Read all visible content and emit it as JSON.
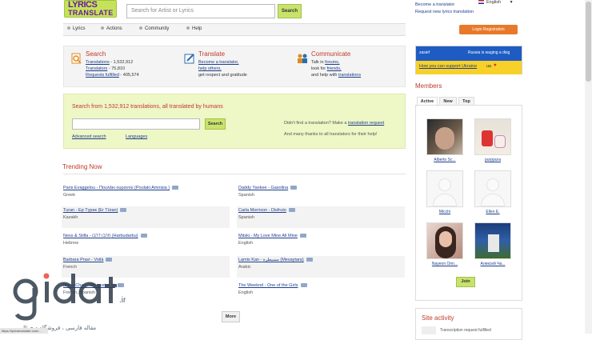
{
  "logo": {
    "line1": "LYRICS",
    "line2": "TRANSLATE"
  },
  "header": {
    "search_placeholder": "Search for Artist or Lyrics",
    "search_button": "Search",
    "link_become_translator": "Become a translator",
    "link_request": "Request new lyrics translation",
    "language": "English",
    "login_label": "Login",
    "register_label": "Registration"
  },
  "nav": [
    {
      "label": "Lyrics"
    },
    {
      "label": "Actions"
    },
    {
      "label": "Community"
    },
    {
      "label": "Help"
    }
  ],
  "features": {
    "search": {
      "title": "Search",
      "l1": "Translations",
      "v1": " - 1,532,912",
      "l2": "Translators",
      "v2": " - 75,810",
      "l3": "Requests fulfilled",
      "v3": " - 405,574"
    },
    "translate": {
      "title": "Translate",
      "l1": "Become a translator,",
      "l2": "help others,",
      "l3": "get respect and gratitude"
    },
    "communicate": {
      "title": "Communicate",
      "t1": "Talk in ",
      "l1": "forums,",
      "t2": "look for ",
      "l2": "friends,",
      "t3": "and help with ",
      "l3": "translations"
    }
  },
  "promo": {
    "heading": "Search from 1,532,912 translations, all translated by humans",
    "button": "Search",
    "advanced": "Advanced search",
    "languages": "Languages",
    "right1a": "Didn't find a translation? Make a ",
    "right1b": "translation request",
    "right2": "And many thanks to all translators for their help!"
  },
  "trending": {
    "title": "Trending Now",
    "left": [
      {
        "song": "Paris Evaggelou - Πουλάκι ουρανού (Poulaki Amnisia )",
        "lang": "Greek"
      },
      {
        "song": "Turan - Ер Түрөк (Er Türan)",
        "lang": "Kazakh"
      },
      {
        "song": "Ness & Stilla - חרבו דרבו (Harbudarbu)",
        "lang": "Hebrew"
      },
      {
        "song": "Barbara Pravi - Voilà",
        "lang": "French"
      },
      {
        "song": "Manu Chao - Me gustas tú",
        "lang": "French, Spanish"
      }
    ],
    "right": [
      {
        "song": "Daddy Yankee - Gasolina",
        "lang": "Spanish"
      },
      {
        "song": "Carla Morrison - Disfruto",
        "lang": "Spanish"
      },
      {
        "song": "Mitski - My Love Mine All Mine",
        "lang": "English"
      },
      {
        "song": "Lamis Kan - مسيطرة (Mesaytara)",
        "lang": "Arabic"
      },
      {
        "song": "The Weeknd - One of the Girls",
        "lang": "English"
      }
    ],
    "more": "More"
  },
  "ukraine": {
    "top_left": "zasief",
    "top_right": "Russia is waging a disg",
    "bottom": "How you can support Ukraine",
    "bottom_suffix": "ua"
  },
  "members": {
    "title": "Members",
    "tabs": [
      "Active",
      "New",
      "Top"
    ],
    "list": [
      {
        "name": "Alberto Sc..."
      },
      {
        "name": "purppura"
      },
      {
        "name": "Micchi"
      },
      {
        "name": "Ellen E."
      },
      {
        "name": "Nayeon Onn..."
      },
      {
        "name": "Алексей Ча..."
      }
    ],
    "join": "Join"
  },
  "activity": {
    "title": "Site activity",
    "item": "Transcription request fulfilled"
  },
  "watermark": {
    "text": "gidat.ir",
    "subtitle": "مقاله فارسی ، فروشگاه دیجیتال"
  },
  "status": "https://lyricstranslate.com/..."
}
